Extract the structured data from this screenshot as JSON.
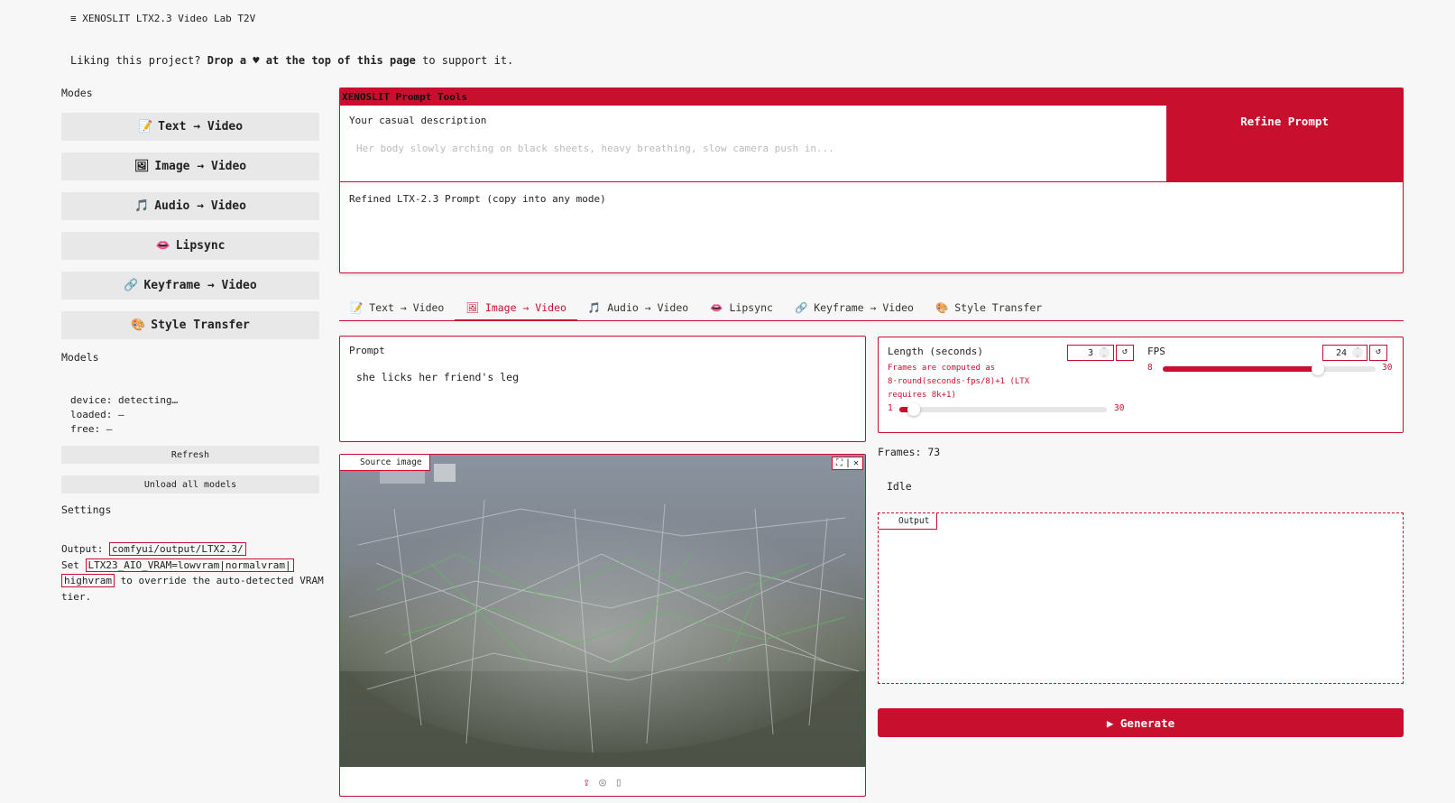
{
  "app": {
    "title": "≡ XENOSLIT LTX2.3 Video Lab T2V"
  },
  "banner": {
    "prefix": "Liking this project? ",
    "bold": "Drop a ♥ at the top of this page",
    "suffix": " to support it."
  },
  "sidebar": {
    "modes_label": "Modes",
    "modes": [
      {
        "icon": "📝",
        "label": "Text → Video"
      },
      {
        "icon": "🖼",
        "label": "Image → Video"
      },
      {
        "icon": "🎵",
        "label": "Audio → Video"
      },
      {
        "icon": "👄",
        "label": "Lipsync"
      },
      {
        "icon": "🔗",
        "label": "Keyframe → Video"
      },
      {
        "icon": "🎨",
        "label": "Style Transfer"
      }
    ],
    "models_label": "Models",
    "models_info": {
      "device": "device: detecting…",
      "loaded": "loaded: —",
      "free": "free: —"
    },
    "refresh_label": "Refresh",
    "unload_label": "Unload all models",
    "settings_label": "Settings",
    "settings": {
      "output_prefix": "Output: ",
      "output_path": "comfyui/output/LTX2.3/",
      "set_prefix": "Set ",
      "env_var_1": "LTX23_AIO_VRAM=lowvram|normalvram|",
      "env_var_2": "highvram",
      "set_suffix": " to override the auto-detected VRAM tier."
    }
  },
  "tools": {
    "header": "XENOSLIT Prompt Tools",
    "casual_label": "Your casual description",
    "casual_placeholder": "Her body slowly arching on black sheets, heavy breathing, slow camera push in...",
    "refine_label": "Refine Prompt",
    "refined_label": "Refined LTX-2.3 Prompt (copy into any mode)"
  },
  "tabs": [
    {
      "icon": "📝",
      "label": "Text → Video",
      "active": false
    },
    {
      "icon": "🖼",
      "label": "Image → Video",
      "active": true
    },
    {
      "icon": "🎵",
      "label": "Audio → Video",
      "active": false
    },
    {
      "icon": "👄",
      "label": "Lipsync",
      "active": false
    },
    {
      "icon": "🔗",
      "label": "Keyframe → Video",
      "active": false
    },
    {
      "icon": "🎨",
      "label": "Style Transfer",
      "active": false
    }
  ],
  "prompt": {
    "label": "Prompt",
    "value": "she licks her friend's leg"
  },
  "source_image": {
    "label": "Source image"
  },
  "length": {
    "label": "Length (seconds)",
    "info": "Frames are computed as 8·round(seconds·fps/8)+1 (LTX requires 8k+1)",
    "value": "3",
    "min": "1",
    "max": "30",
    "fraction": 0.069
  },
  "fps": {
    "label": "FPS",
    "value": "24",
    "min": "8",
    "max": "30",
    "fraction": 0.727
  },
  "reset_icon": "↺",
  "frames_text": "Frames: 73",
  "status_text": "Idle",
  "output": {
    "label": "Output"
  },
  "generate_label": "▶ Generate",
  "colors": {
    "accent": "#c8102e",
    "background": "#f7f7f7"
  }
}
